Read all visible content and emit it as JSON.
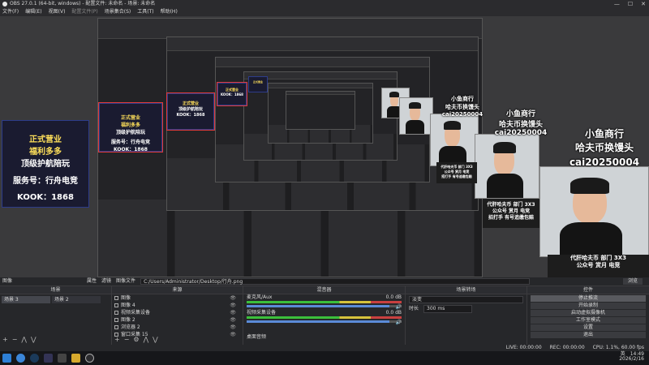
{
  "titlebar": {
    "title": "OBS 27.0.1 (64-bit, windows) - 配置文件: 未命名 - 场景: 未命名"
  },
  "menu": [
    "文件(F)",
    "编辑(E)",
    "视图(V)",
    "配置文件(P)",
    "场景集合(S)",
    "工具(T)",
    "帮助(H)"
  ],
  "overlay": {
    "card_line1": "正式营业",
    "card_line2": "福利多多",
    "card_line3": "顶级护航陪玩",
    "card_line4": "服务号：行舟电竞",
    "card_line5": "KOOK：1868",
    "promo_line1": "小鱼商行",
    "promo_line2": "哈夫币换馒头",
    "promo_line3": "cai20250004",
    "banner_line1": "代肝哈夫币 部门 3X3",
    "banner_line2": "公众号 赏月 电竞",
    "banner_line3": "招打手 有号追缴包赔"
  },
  "dock_header": {
    "tab1": "属性",
    "tab2": "滤镜",
    "tab3": "图像文件",
    "path": "C:/Users/Administrator/Desktop/行舟.png",
    "browse": "浏览",
    "label": "图像"
  },
  "scenes": {
    "title": "场景",
    "items": [
      "场景 3",
      "场景 2"
    ]
  },
  "sources": {
    "title": "来源",
    "items": [
      "图像",
      "图像 4",
      "视频采集设备",
      "图像 2",
      "浏览器 2",
      "窗口采集 15"
    ]
  },
  "mixer": {
    "title": "混音器",
    "ch1_name": "麦克风/Aux",
    "ch1_db": "0.0 dB",
    "ch2_name": "视频采集设备",
    "ch2_db": "0.0 dB",
    "ch3_name": "桌面音频",
    "ch1_vol": 0.92,
    "ch2_vol": 0.92
  },
  "transitions": {
    "title": "场景转场",
    "type": "淡变",
    "duration_label": "时长",
    "duration": "300 ms"
  },
  "controls": {
    "title": "控件",
    "buttons": [
      "停止推流",
      "开始录制",
      "启动虚拟摄像机",
      "工作室模式",
      "设置",
      "退出"
    ]
  },
  "status": {
    "live": "LIVE: 00:00:00",
    "rec": "REC: 00:00:00",
    "cpu": "CPU: 1.1%, 60.00 fps"
  },
  "taskbar": {
    "time": "14:49",
    "date": "2026/2/16",
    "lang": "英"
  }
}
